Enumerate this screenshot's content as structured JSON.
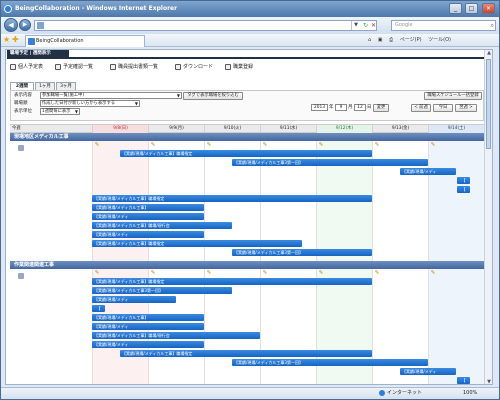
{
  "window": {
    "title": "BeingCollaboration - Windows Internet Explorer"
  },
  "search": {
    "placeholder": "Google"
  },
  "tab": {
    "label": "BeingCollaboration"
  },
  "toolbar": {
    "page": "ページ(P)",
    "tools": "ツール(O)"
  },
  "page": {
    "title": "職場予定 | 週間表示",
    "menu": [
      "個人予定表",
      "予定確認一覧",
      "職員提出書類一覧",
      "ダウンロード",
      "職業登録"
    ],
    "view_tabs": [
      "2週間",
      "1ヶ月",
      "3ヶ月"
    ],
    "filter": {
      "content_label": "表示内容",
      "content_value": "参加職場一覧(施工中)",
      "tag_toggle": "タグで表示職場を絞り込む",
      "order_label": "職場順",
      "order_value": "作成した日付が新しい方から表示する",
      "unit_label": "表示単位",
      "unit_value": "1週間毎に表示",
      "year": "2013",
      "month": "9",
      "day": "12",
      "year_unit": "年",
      "month_unit": "月",
      "day_unit": "日",
      "change_btn": "変更",
      "prev_btn": "< 前週",
      "today_btn": "今日",
      "next_btn": "翌週 >",
      "register_btn": "職場スケジュール一括登録"
    },
    "days": [
      "今週",
      "9/8(日)",
      "9/9(月)",
      "9/10(火)",
      "9/11(水)",
      "9/12(木)",
      "9/13(金)",
      "9/14(土)"
    ],
    "sections": [
      {
        "title": "現場地区メディカル工事",
        "bars": [
          "【実績/現場/メディカル工事】職場指定",
          "【実績/現場/メディカル工事3第一回】",
          "【実績/現場/メディ",
          "【",
          "【",
          "【実績/現場/メディカル工事】職場指定",
          "【実績/現場/メディカル工事】",
          "【実績/現場/メディ",
          "【実績/現場/メディカル工事】職場/現行会",
          "【実績/現場/メディ",
          "【実績/現場/メディカル工事】職場指定",
          "【実績/現場/メディカル工事3第一回】"
        ]
      },
      {
        "title": "作業関連関連工事",
        "bars": [
          "【実績/現場/メディカル工事】職場指定",
          "【実績/現場/メディカル工事3第一回】",
          "【実績/現場/メディ",
          "【",
          "【実績/現場/メディカル工事】",
          "【実績/現場/メディ",
          "【実績/現場/メディカル工事】職場/現行会",
          "【実績/現場/メディ",
          "【実績/現場/メディカル工事】職場指定",
          "【実績/現場/メディカル工事3第一回】",
          "【実績/現場/メディ",
          "【",
          "【"
        ]
      }
    ]
  },
  "status": {
    "zone": "インターネット",
    "zoom": "100%"
  }
}
